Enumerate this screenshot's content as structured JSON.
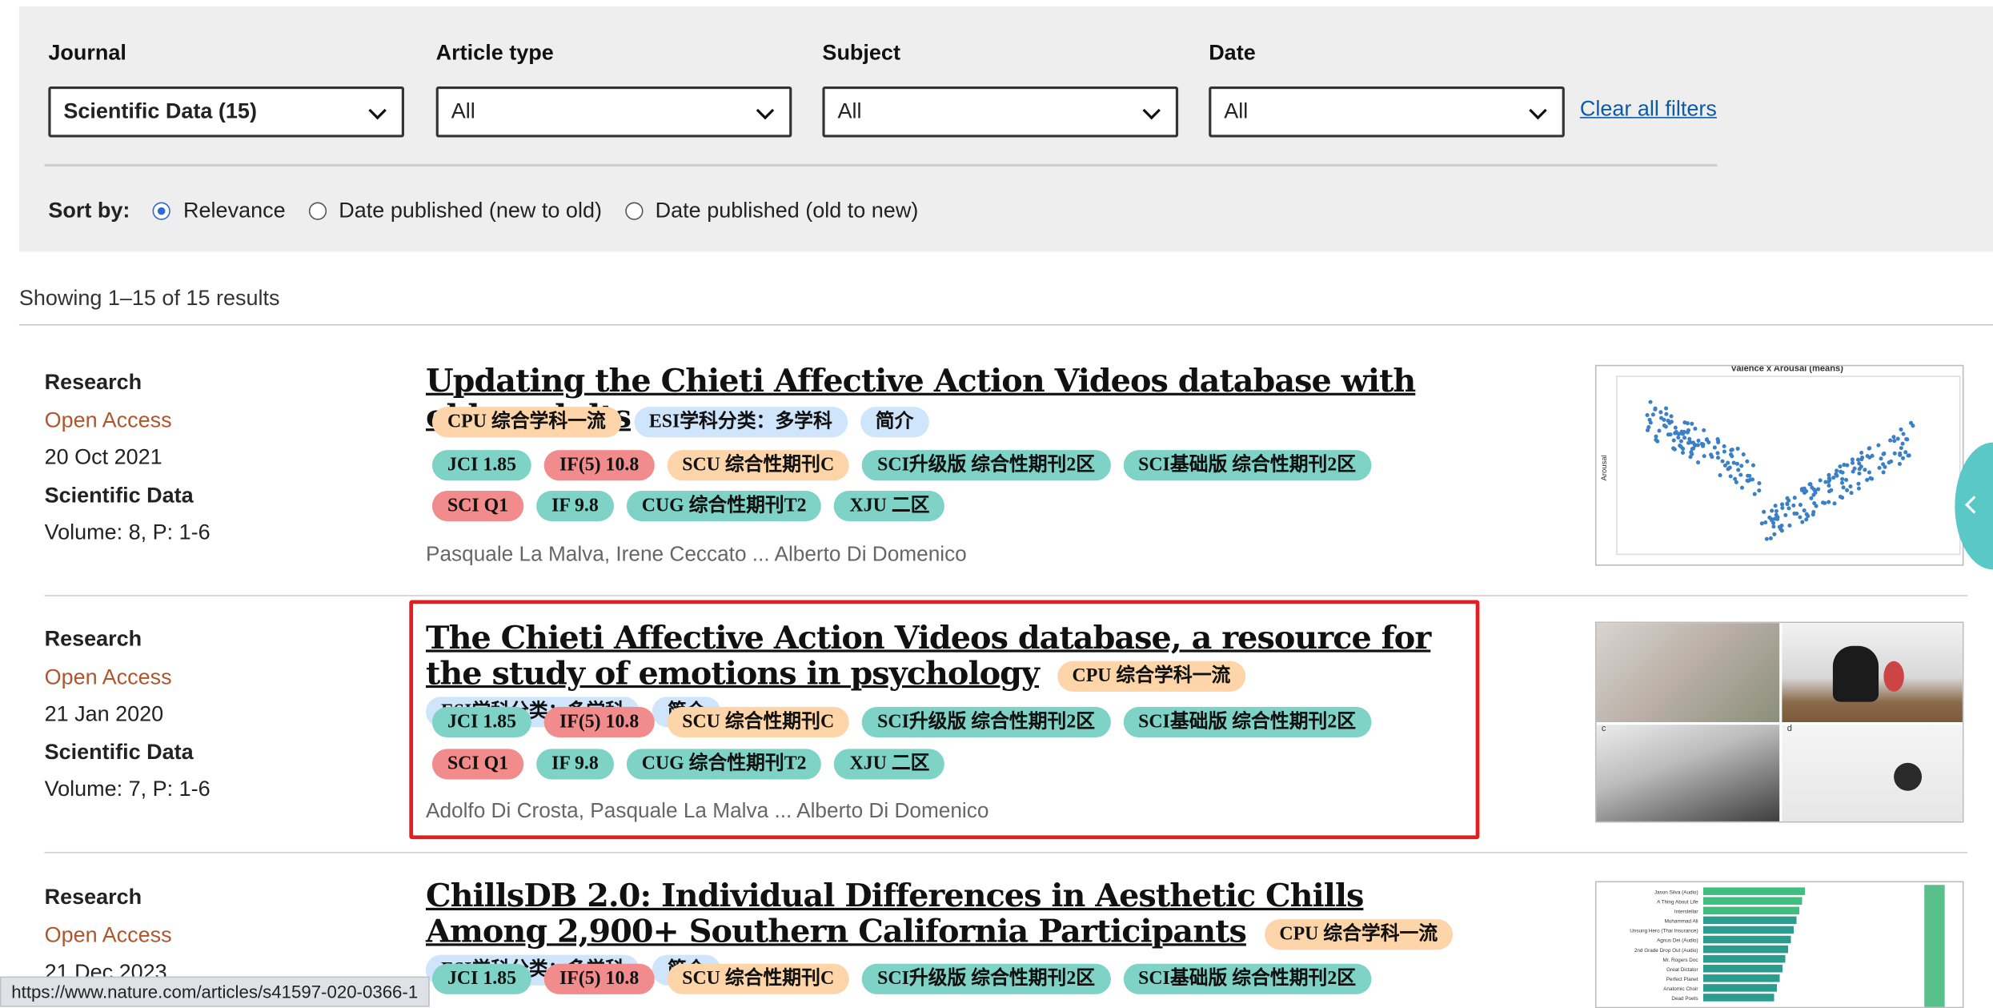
{
  "filters": {
    "journal": {
      "label": "Journal",
      "value": "Scientific Data (15)"
    },
    "article_type": {
      "label": "Article type",
      "value": "All"
    },
    "subject": {
      "label": "Subject",
      "value": "All"
    },
    "date": {
      "label": "Date",
      "value": "All"
    },
    "clear_all": "Clear all filters"
  },
  "sort": {
    "label": "Sort by:",
    "options": [
      "Relevance",
      "Date published (new to old)",
      "Date published (old to new)"
    ],
    "selected": "Relevance"
  },
  "showing": "Showing 1–15 of 15 results",
  "tags": {
    "cpu": "CPU 综合学科一流",
    "esi": "ESI学科分类：多学科",
    "intro": "简介",
    "jci": "JCI 1.85",
    "if5": "IF(5) 10.8",
    "scu": "SCU 综合性期刊C",
    "sci_up": "SCI升级版 综合性期刊2区",
    "sci_base": "SCI基础版 综合性期刊2区",
    "sciq": "SCI Q1",
    "if": "IF 9.8",
    "cug": "CUG 综合性期刊T2",
    "xju": "XJU 二区"
  },
  "results": [
    {
      "type": "Research",
      "access": "Open Access",
      "date": "20 Oct 2021",
      "journal": "Scientific Data",
      "volume": "Volume: 8, P: 1-6",
      "title": "Updating the Chieti Affective Action Videos database with older adults",
      "authors": "Pasquale La Malva, Irene Ceccato ... Alberto Di Domenico",
      "thumb_title": "Valence x Arousal (means)",
      "thumb_ylabel": "Arousal"
    },
    {
      "type": "Research",
      "access": "Open Access",
      "date": "21 Jan 2020",
      "journal": "Scientific Data",
      "volume": "Volume: 7, P: 1-6",
      "title": "The Chieti Affective Action Videos database, a resource for the study of emotions in psychology",
      "authors": "Adolfo Di Crosta, Pasquale La Malva ... Alberto Di Domenico",
      "thumb_labels": [
        "c",
        "d"
      ]
    },
    {
      "type": "Research",
      "access": "Open Access",
      "date": "21 Dec 2023",
      "journal": "",
      "volume": "",
      "title": "ChillsDB 2.0: Individual Differences in Aesthetic Chills Among 2,900+ Southern California Participants",
      "authors": "",
      "thumb_labels": [
        "Jason Silva (Audio)",
        "A Thing About Life",
        "Interstellar",
        "Muhammad Ali",
        "Unsung Hero (Thai Insurance)",
        "Agnus Dei (Audio)",
        "2nd Grade Drop Out (Audio)",
        "Mr. Rogers Doc",
        "Great Dictator",
        "Perfect Planet",
        "Anatomic Choir",
        "Dead Poets"
      ]
    }
  ],
  "status_url": "https://www.nature.com/articles/s41597-020-0366-1"
}
